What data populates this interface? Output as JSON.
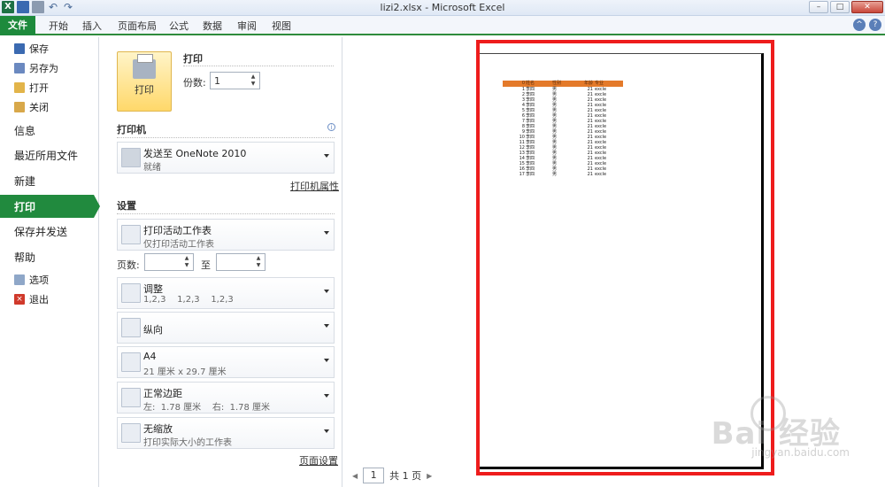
{
  "window": {
    "title": "lizi2.xlsx - Microsoft Excel"
  },
  "ribbon": {
    "file": "文件",
    "tabs": [
      "开始",
      "插入",
      "页面布局",
      "公式",
      "数据",
      "审阅",
      "视图"
    ]
  },
  "nav": {
    "save": "保存",
    "save_as": "另存为",
    "open": "打开",
    "close": "关闭",
    "info": "信息",
    "recent": "最近所用文件",
    "new": "新建",
    "print": "打印",
    "save_send": "保存并发送",
    "help": "帮助",
    "options": "选项",
    "exit": "退出"
  },
  "print": {
    "button": "打印",
    "section": "打印",
    "copies_label": "份数:",
    "copies": "1"
  },
  "printer": {
    "section": "打印机",
    "name": "发送至 OneNote 2010",
    "status": "就绪",
    "properties_link": "打印机属性"
  },
  "settings": {
    "section": "设置",
    "scope_title": "打印活动工作表",
    "scope_sub": "仅打印活动工作表",
    "pages_label": "页数:",
    "pages_to": "至",
    "collate_title": "调整",
    "collate_sub": "1,2,3    1,2,3    1,2,3",
    "orientation": "纵向",
    "paper_title": "A4",
    "paper_sub": "21 厘米 x 29.7 厘米",
    "margins_title": "正常边距",
    "margins_sub": "左:  1.78 厘米    右:  1.78 厘米",
    "scaling_title": "无缩放",
    "scaling_sub": "打印实际大小的工作表",
    "page_setup_link": "页面设置"
  },
  "preview": {
    "page_current": "1",
    "page_total": "共 1 页",
    "headers": [
      "0",
      "姓名",
      "性别",
      "年龄",
      "专业"
    ],
    "rows": [
      [
        "1",
        "李四",
        "男",
        "21",
        "excle"
      ],
      [
        "2",
        "李四",
        "男",
        "21",
        "excle"
      ],
      [
        "3",
        "李四",
        "男",
        "21",
        "excle"
      ],
      [
        "4",
        "李四",
        "男",
        "21",
        "excle"
      ],
      [
        "5",
        "李四",
        "男",
        "21",
        "excle"
      ],
      [
        "6",
        "李四",
        "男",
        "21",
        "excle"
      ],
      [
        "7",
        "李四",
        "男",
        "21",
        "excle"
      ],
      [
        "8",
        "李四",
        "男",
        "21",
        "excle"
      ],
      [
        "9",
        "李四",
        "男",
        "21",
        "excle"
      ],
      [
        "10",
        "李四",
        "男",
        "21",
        "excle"
      ],
      [
        "11",
        "李四",
        "男",
        "21",
        "excle"
      ],
      [
        "12",
        "李四",
        "男",
        "21",
        "excle"
      ],
      [
        "13",
        "李四",
        "男",
        "21",
        "excle"
      ],
      [
        "14",
        "李四",
        "男",
        "21",
        "excle"
      ],
      [
        "15",
        "李四",
        "男",
        "21",
        "excle"
      ],
      [
        "16",
        "李四",
        "男",
        "21",
        "excle"
      ],
      [
        "17",
        "李四",
        "男",
        "21",
        "excle"
      ]
    ]
  },
  "watermark": {
    "brand": "Bai 经验",
    "url": "jingyan.baidu.com"
  },
  "colors": {
    "accent": "#218a3e",
    "highlight": "#ee1c1c",
    "header_fill": "#e47a2a"
  }
}
